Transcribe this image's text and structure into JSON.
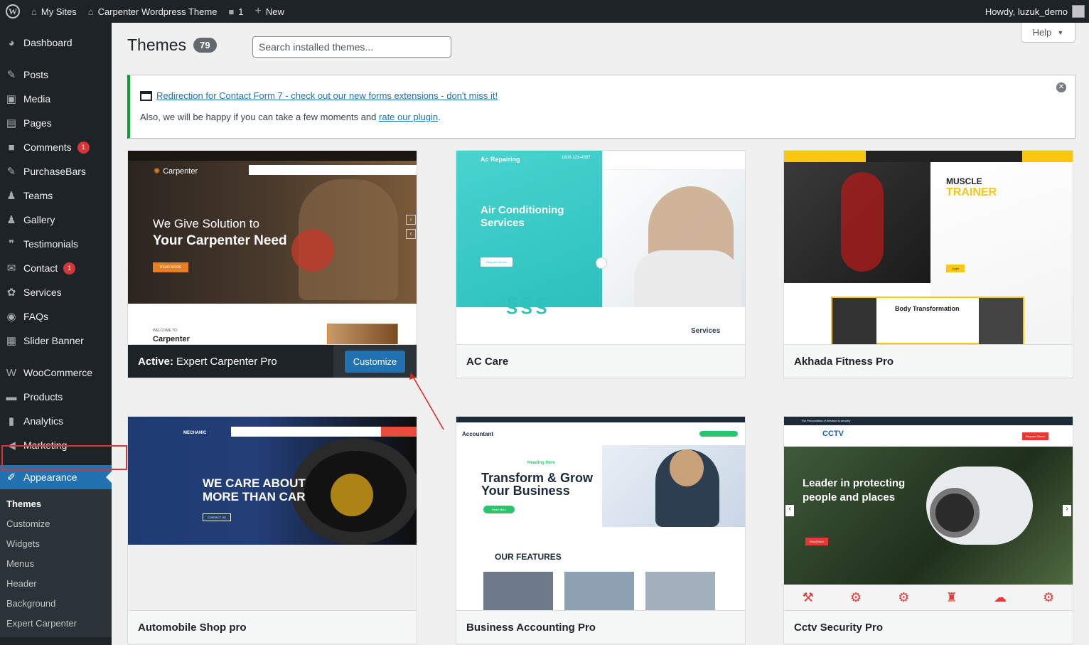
{
  "adminbar": {
    "my_sites": "My Sites",
    "site_name": "Carpenter Wordpress Theme",
    "comments_count": "1",
    "new_label": "New",
    "howdy": "Howdy, luzuk_demo"
  },
  "sidebar": {
    "items": [
      {
        "label": "Dashboard",
        "icon": "dashboard-icon",
        "glyph": "◕"
      },
      {
        "label": "Posts",
        "icon": "pin-icon",
        "glyph": "✎"
      },
      {
        "label": "Media",
        "icon": "media-icon",
        "glyph": "▣"
      },
      {
        "label": "Pages",
        "icon": "pages-icon",
        "glyph": "▤"
      },
      {
        "label": "Comments",
        "icon": "comments-icon",
        "glyph": "■",
        "badge": "1"
      },
      {
        "label": "PurchaseBars",
        "icon": "pin-icon",
        "glyph": "✎"
      },
      {
        "label": "Teams",
        "icon": "groups-icon",
        "glyph": "♟"
      },
      {
        "label": "Gallery",
        "icon": "groups-icon",
        "glyph": "♟"
      },
      {
        "label": "Testimonials",
        "icon": "testimonial-icon",
        "glyph": "❞"
      },
      {
        "label": "Contact",
        "icon": "email-icon",
        "glyph": "✉",
        "badge": "1"
      },
      {
        "label": "Services",
        "icon": "services-icon",
        "glyph": "✿"
      },
      {
        "label": "FAQs",
        "icon": "faq-icon",
        "glyph": "◉"
      },
      {
        "label": "Slider Banner",
        "icon": "slider-icon",
        "glyph": "▦"
      },
      {
        "label": "WooCommerce",
        "icon": "woo-icon",
        "glyph": "W"
      },
      {
        "label": "Products",
        "icon": "products-icon",
        "glyph": "▬"
      },
      {
        "label": "Analytics",
        "icon": "analytics-icon",
        "glyph": "▮"
      },
      {
        "label": "Marketing",
        "icon": "megaphone-icon",
        "glyph": "◀"
      },
      {
        "label": "Appearance",
        "icon": "brush-icon",
        "glyph": "✐"
      }
    ],
    "submenu": [
      "Themes",
      "Customize",
      "Widgets",
      "Menus",
      "Header",
      "Background",
      "Expert Carpenter"
    ]
  },
  "header": {
    "help_label": "Help",
    "title": "Themes",
    "count": "79",
    "search_placeholder": "Search installed themes..."
  },
  "notice": {
    "link_text": "Redirection for Contact Form 7 - check out our new forms extensions - don't miss it!",
    "line2_prefix": "Also, we will be happy if you can take a few moments and ",
    "line2_link": "rate our plugin",
    "line2_suffix": "."
  },
  "themes": [
    {
      "name": "Expert Carpenter Pro",
      "active_label": "Active:",
      "button": "Customize"
    },
    {
      "name": "AC Care"
    },
    {
      "name": "Akhada Fitness Pro"
    },
    {
      "name": "Automobile Shop pro"
    },
    {
      "name": "Business Accounting Pro"
    },
    {
      "name": "Cctv Security Pro"
    }
  ],
  "previews": {
    "carpenter": {
      "brand": "Carpenter",
      "line1": "We Give Solution to",
      "line2": "Your Carpenter Need",
      "cta": "READ MORE",
      "welcome": "WELCOME TO",
      "welcome2": "Carpenter"
    },
    "ac": {
      "brand": "Ac Repairing",
      "phone": "1800-123-4567",
      "heading1": "Air Conditioning",
      "heading2": "Services",
      "cta": "Request Service",
      "services": "Services"
    },
    "fitness": {
      "heading1": "MUSCLE",
      "heading2": "TRAINER",
      "cta": "Login",
      "body": "Body Transformation"
    },
    "auto": {
      "brand": "MECHANIC",
      "line1": "WE CARE ABOUT",
      "line2": "MORE THAN CAR",
      "cta": "CONTACT US"
    },
    "accounting": {
      "brand": "Accountant",
      "kicker": "Heading Here",
      "line1": "Transform & Grow",
      "line2": "Your Business",
      "cta": "Read More",
      "features": "OUR FEATURES"
    },
    "cctv": {
      "brand": "CCTV",
      "line1": "Leader in protecting",
      "line2": "people and places",
      "cta": "Read More",
      "top_bar": "The Precondition of freedom is security",
      "btn": "Request Demo"
    }
  }
}
